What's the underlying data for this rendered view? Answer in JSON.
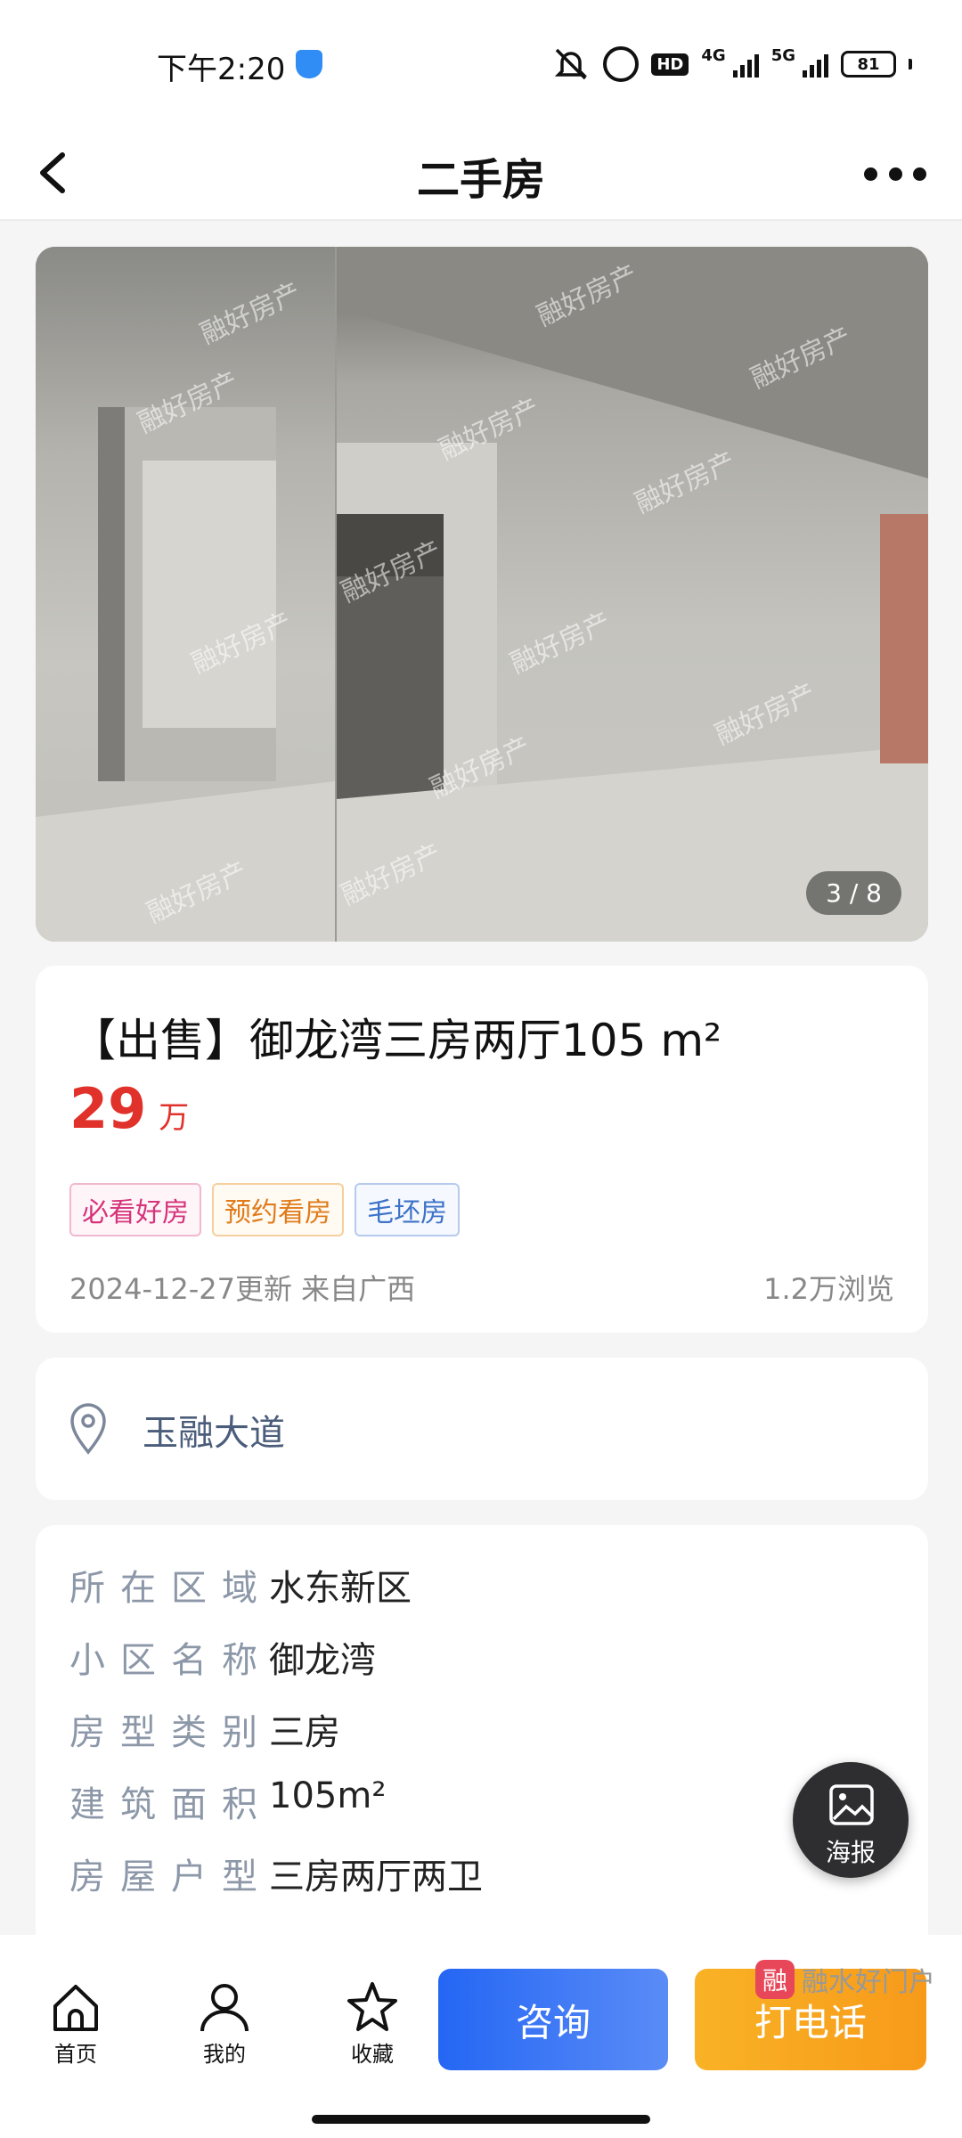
{
  "status_bar": {
    "time": "下午2:20",
    "hd": "HD",
    "net_4g": "4G",
    "net_5g": "5G",
    "battery": "81"
  },
  "nav": {
    "title": "二手房"
  },
  "gallery": {
    "counter": "3 / 8",
    "watermark": "融好房产"
  },
  "listing": {
    "title": "【出售】御龙湾三房两厅105 m²",
    "price": "29",
    "price_unit": "万",
    "tags": [
      "必看好房",
      "预约看房",
      "毛坯房"
    ],
    "meta_left": "2024-12-27更新 来自广西",
    "meta_right": "1.2万浏览"
  },
  "location": {
    "address": "玉融大道"
  },
  "details": [
    {
      "label": "所在区域",
      "value": "水东新区"
    },
    {
      "label": "小区名称",
      "value": "御龙湾"
    },
    {
      "label": "房型类别",
      "value": "三房"
    },
    {
      "label": "建筑面积",
      "value": "105m²"
    },
    {
      "label": "房屋户型",
      "value": "三房两厅两卫"
    }
  ],
  "poster": {
    "label": "海报"
  },
  "bottom_bar": {
    "home_label": "首页",
    "mine_label": "我的",
    "fav_label": "收藏",
    "consult_label": "咨询",
    "call_label": "打电话"
  },
  "brand": {
    "logo_char": "融",
    "name": "融水好门户"
  }
}
